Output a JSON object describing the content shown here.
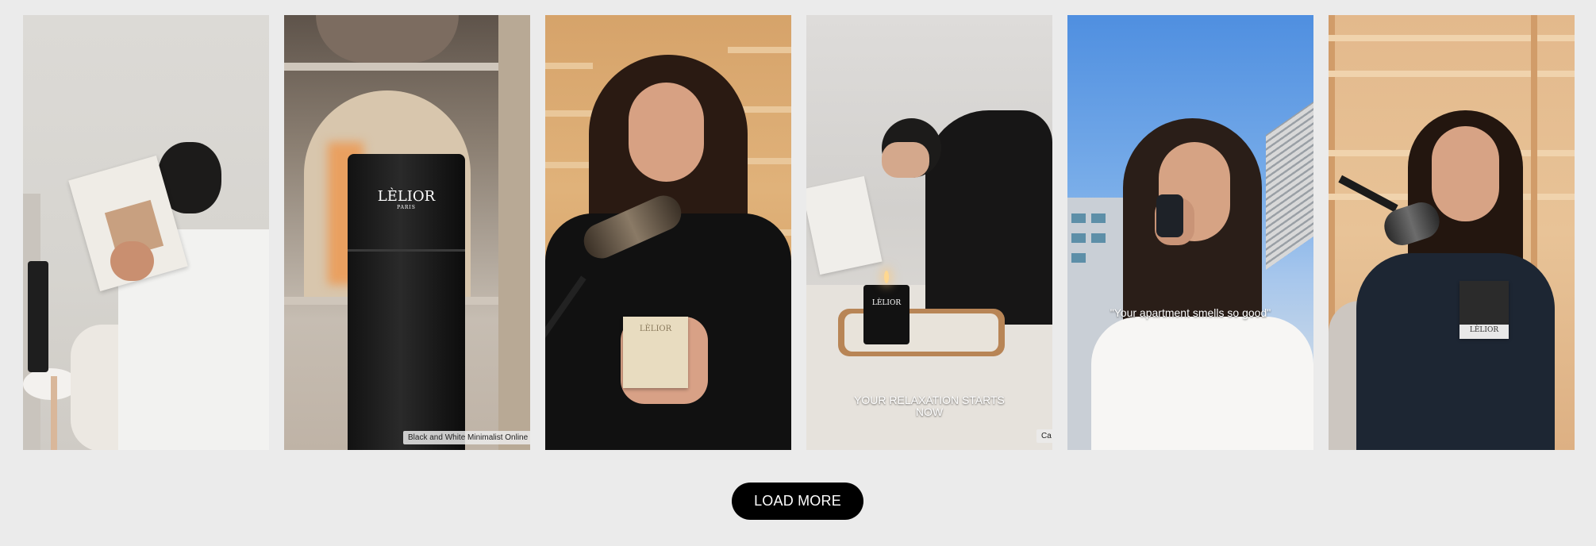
{
  "gallery": {
    "items": [
      {
        "alt": "Woman reading a book beside a diffuser tower"
      },
      {
        "alt": "Black diffuser tower on a shelf",
        "tag": "Black and White Minimalist Online Mark",
        "brand": "LÈLIOR",
        "brand_sub": "PARIS"
      },
      {
        "alt": "Woman holding a candle box at a podcast microphone",
        "box_label": "LÈLIOR"
      },
      {
        "alt": "Woman reading in bed with a lit candle",
        "caption": "YOUR RELAXATION STARTS NOW",
        "tag": "Ca",
        "candle_label": "LÈLIOR"
      },
      {
        "alt": "Woman smelling a perfume bottle outdoors",
        "caption": "\"Your apartment smells so good\""
      },
      {
        "alt": "Woman holding a box at a podcast microphone",
        "box_label": "LÈLIOR"
      }
    ]
  },
  "actions": {
    "load_more_label": "LOAD MORE"
  },
  "colors": {
    "page_bg": "#ebebeb",
    "button_bg": "#000000",
    "button_text": "#ffffff"
  }
}
